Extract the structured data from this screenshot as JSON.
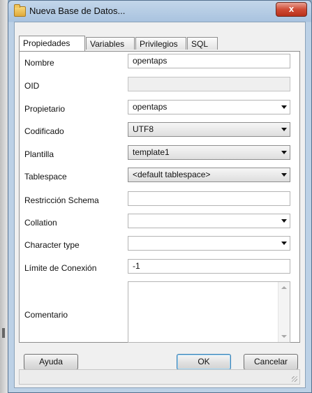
{
  "window": {
    "title": "Nueva Base de Datos...",
    "close_label": "x"
  },
  "tabs": [
    {
      "label": "Propiedades",
      "active": true
    },
    {
      "label": "Variables",
      "active": false
    },
    {
      "label": "Privilegios",
      "active": false
    },
    {
      "label": "SQL",
      "active": false
    }
  ],
  "form": {
    "nombre": {
      "label": "Nombre",
      "value": "opentaps"
    },
    "oid": {
      "label": "OID",
      "value": ""
    },
    "propietario": {
      "label": "Propietario",
      "value": "opentaps"
    },
    "codificado": {
      "label": "Codificado",
      "value": "UTF8"
    },
    "plantilla": {
      "label": "Plantilla",
      "value": "template1"
    },
    "tablespace": {
      "label": "Tablespace",
      "value": "<default tablespace>"
    },
    "restriccion_schema": {
      "label": "Restricción Schema",
      "value": ""
    },
    "collation": {
      "label": "Collation",
      "value": ""
    },
    "character_type": {
      "label": "Character type",
      "value": ""
    },
    "limite_conexion": {
      "label": "Límite de Conexión",
      "value": "-1"
    },
    "comentario": {
      "label": "Comentario",
      "value": ""
    }
  },
  "buttons": {
    "help": "Ayuda",
    "ok": "OK",
    "cancel": "Cancelar"
  },
  "colors": {
    "title_bar": "#a9c3df",
    "close_button": "#cf4b35",
    "default_button_border": "#3c7fb1"
  },
  "icons": {
    "window": "database-icon",
    "combo": "chevron-down-icon"
  }
}
